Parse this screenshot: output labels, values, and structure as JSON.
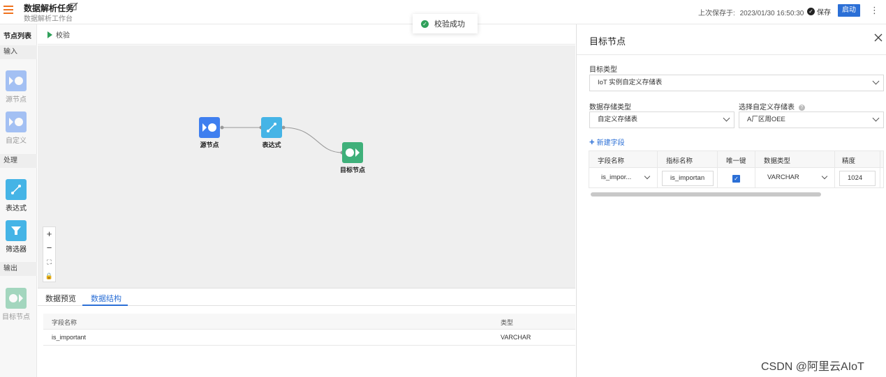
{
  "header": {
    "title": "数据解析任务",
    "subtitle": "数据解析工作台",
    "last_saved_label": "上次保存于:",
    "last_saved_time": "2023/01/30 16:50:30",
    "save_label": "保存",
    "start_label": "启动"
  },
  "toast": {
    "message": "校验成功"
  },
  "sidebar": {
    "title": "节点列表",
    "sections": [
      {
        "label": "输入",
        "items": [
          {
            "label": "源节点",
            "icon": "source-node-icon"
          },
          {
            "label": "自定义",
            "icon": "custom-node-icon"
          }
        ]
      },
      {
        "label": "处理",
        "items": [
          {
            "label": "表达式",
            "icon": "expression-icon"
          },
          {
            "label": "筛选器",
            "icon": "filter-icon"
          }
        ]
      },
      {
        "label": "输出",
        "items": [
          {
            "label": "目标节点",
            "icon": "target-node-icon"
          }
        ]
      }
    ]
  },
  "toolbar": {
    "validate_label": "校验"
  },
  "canvas": {
    "nodes": [
      {
        "label": "源节点",
        "color": "#3f7fef"
      },
      {
        "label": "表达式",
        "color": "#45b4e6"
      },
      {
        "label": "目标节点",
        "color": "#3fb07a"
      }
    ],
    "zoom_controls": [
      "+",
      "−",
      "⛶",
      "🔒"
    ]
  },
  "bottom": {
    "tabs": [
      {
        "label": "数据预览"
      },
      {
        "label": "数据结构",
        "active": true
      }
    ],
    "columns": [
      "字段名称",
      "类型"
    ],
    "rows": [
      {
        "name": "is_important",
        "type": "VARCHAR"
      }
    ]
  },
  "panel": {
    "title": "目标节点",
    "target_type_label": "目标类型",
    "target_type_value": "IoT 实例自定义存储表",
    "storage_type_label": "数据存储类型",
    "storage_type_value": "自定义存储表",
    "custom_table_label": "选择自定义存储表",
    "custom_table_value": "A厂区周OEE",
    "add_field_label": "新建字段",
    "field_columns": [
      "字段名称",
      "指标名称",
      "唯一键",
      "数据类型",
      "精度"
    ],
    "field_row": {
      "field_name": "is_impor...",
      "metric_name": "is_importan",
      "unique": true,
      "data_type": "VARCHAR",
      "precision": "1024"
    }
  },
  "watermark": "CSDN @阿里云AIoT",
  "colors": {
    "accent": "#2b6fd6",
    "success": "#2fa05a",
    "menu": "#f0731f"
  }
}
